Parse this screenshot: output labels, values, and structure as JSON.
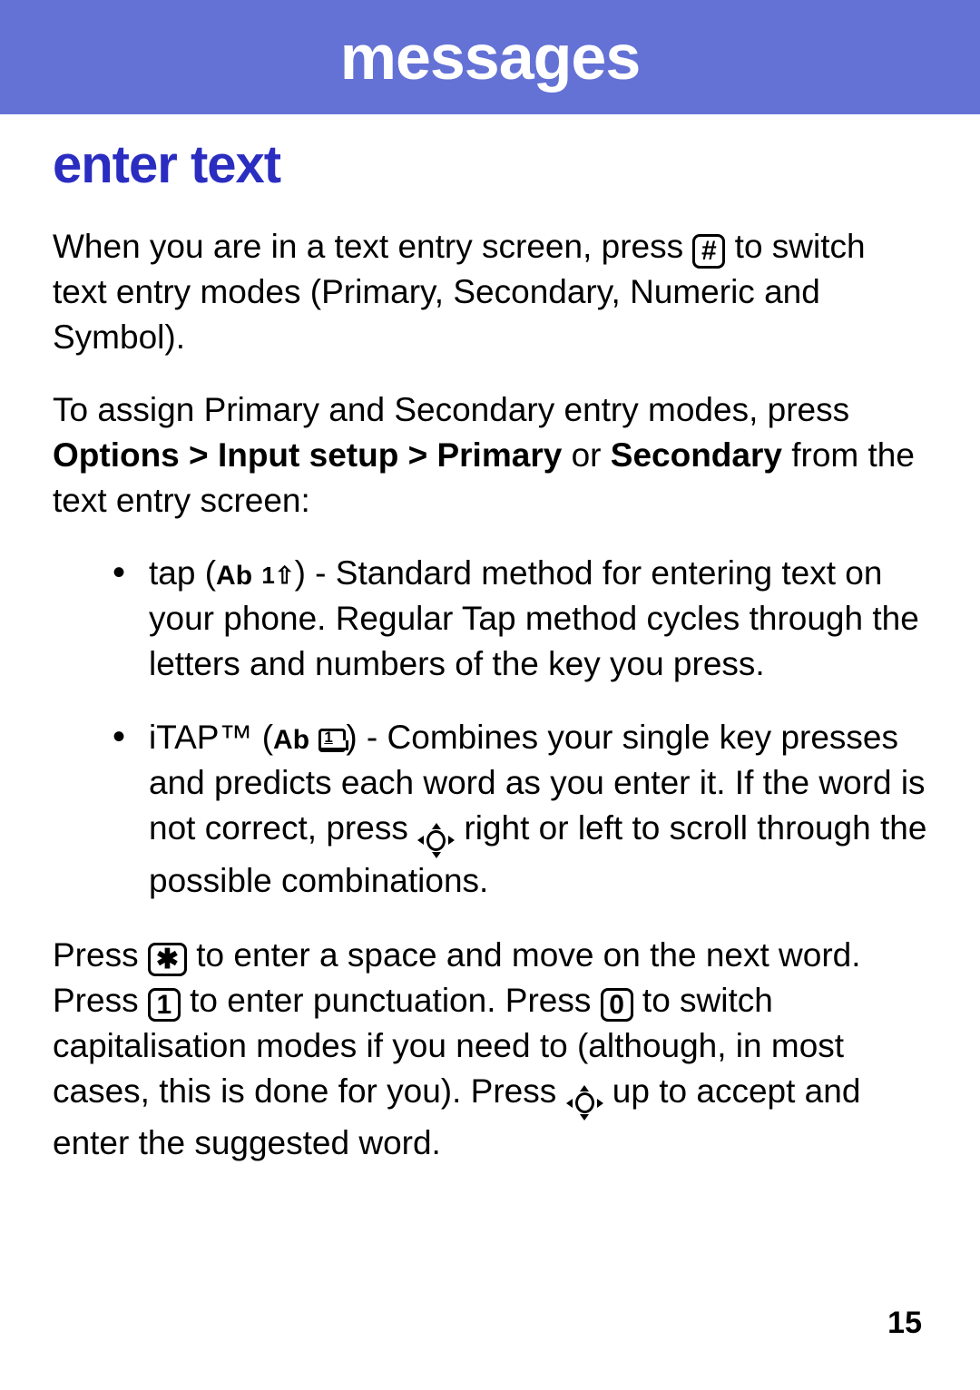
{
  "header": {
    "title": "messages"
  },
  "section": {
    "title": "enter text"
  },
  "keys": {
    "hash": "#",
    "star": "✱",
    "one": "1",
    "zero": "0"
  },
  "labels": {
    "ab": "Ab"
  },
  "para1": {
    "a": "When you are in a text entry screen, press ",
    "b": " to switch text entry modes (Primary, Secondary, Numeric and Symbol)."
  },
  "para2": {
    "a": "To assign Primary and Secondary entry modes, press ",
    "bold1": "Options",
    "gt1": " > ",
    "bold2": "Input setup",
    "gt2": " > ",
    "bold3": "Primary",
    "or": " or ",
    "bold4": "Secondary",
    "b": " from the text entry screen:"
  },
  "bullets": [
    {
      "a": "tap (",
      "tap_glyph": "1⇧",
      "b": ") - Standard method for entering text on your phone. Regular Tap method cycles through the letters and numbers of the key you press."
    },
    {
      "a": "iTAP™ (",
      "b": ") - Combines your single key presses and predicts each word as you enter it. If the word is not correct, press ",
      "c": " right or left to scroll through the possible combinations."
    }
  ],
  "para3": {
    "a": "Press ",
    "b": " to enter a space and move on the next word. Press ",
    "c": " to enter punctuation. Press ",
    "d": " to switch capitalisation modes if you need to (although, in most cases, this is done for you). Press ",
    "e": " up to accept and enter the suggested word."
  },
  "page_number": "15"
}
